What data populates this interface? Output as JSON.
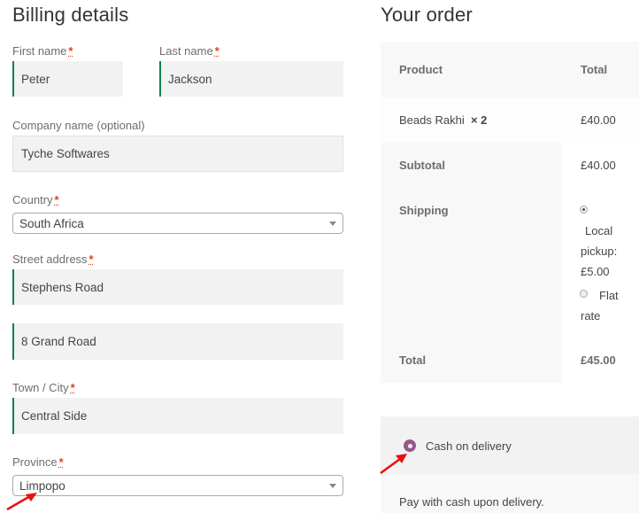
{
  "billing": {
    "title": "Billing details",
    "required_mark": "*",
    "first_name": {
      "label": "First name",
      "value": "Peter"
    },
    "last_name": {
      "label": "Last name",
      "value": "Jackson"
    },
    "company": {
      "label": "Company name (optional)",
      "value": "Tyche Softwares"
    },
    "country": {
      "label": "Country",
      "value": "South Africa"
    },
    "street": {
      "label": "Street address",
      "value1": "Stephens Road",
      "value2": "8 Grand Road"
    },
    "city": {
      "label": "Town / City",
      "value": "Central Side"
    },
    "province": {
      "label": "Province",
      "value": "Limpopo"
    }
  },
  "order": {
    "title": "Your order",
    "headers": {
      "product": "Product",
      "total": "Total"
    },
    "item": {
      "name": "Beads Rakhi",
      "qty": "× 2",
      "total": "£40.00"
    },
    "subtotal": {
      "label": "Subtotal",
      "value": "£40.00"
    },
    "shipping": {
      "label": "Shipping",
      "options": [
        {
          "line1": "Local",
          "line2": "pickup:",
          "line3": "£5.00",
          "selected": true
        },
        {
          "line1": "Flat",
          "line2": "rate",
          "selected": false
        }
      ]
    },
    "total": {
      "label": "Total",
      "value": "£45.00"
    }
  },
  "payment": {
    "method": "Cash on delivery",
    "description": "Pay with cash upon delivery."
  },
  "colors": {
    "accent": "#96588a",
    "valid_border": "#0f834d",
    "annotation_arrow": "#e8110f"
  }
}
